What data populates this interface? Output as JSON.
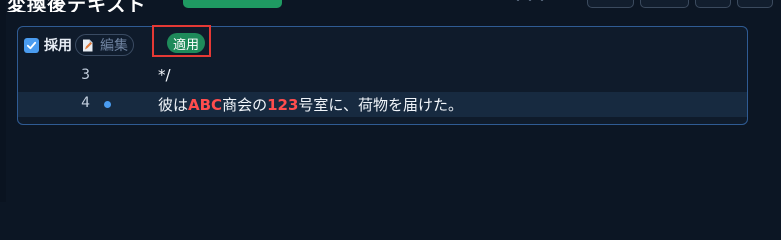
{
  "header": {
    "title": "変換後テキスト",
    "faint_text": "・・・"
  },
  "review": {
    "adopt_label": "採用",
    "edit_label": "編集",
    "apply_label": "適用",
    "checked": true
  },
  "lines": [
    {
      "number": "3",
      "text": "*/",
      "marker": false
    },
    {
      "number": "4",
      "marker": true,
      "segments": {
        "s1": "彼は",
        "h1": "ABC",
        "s2": "商会の",
        "h2": "123",
        "s3": "号室に、荷物を届けた。"
      }
    }
  ],
  "colors": {
    "accent": "#4a9cf0",
    "apply": "#1e8a5a",
    "highlight": "#ff4d4d",
    "annotation": "#e53935"
  }
}
